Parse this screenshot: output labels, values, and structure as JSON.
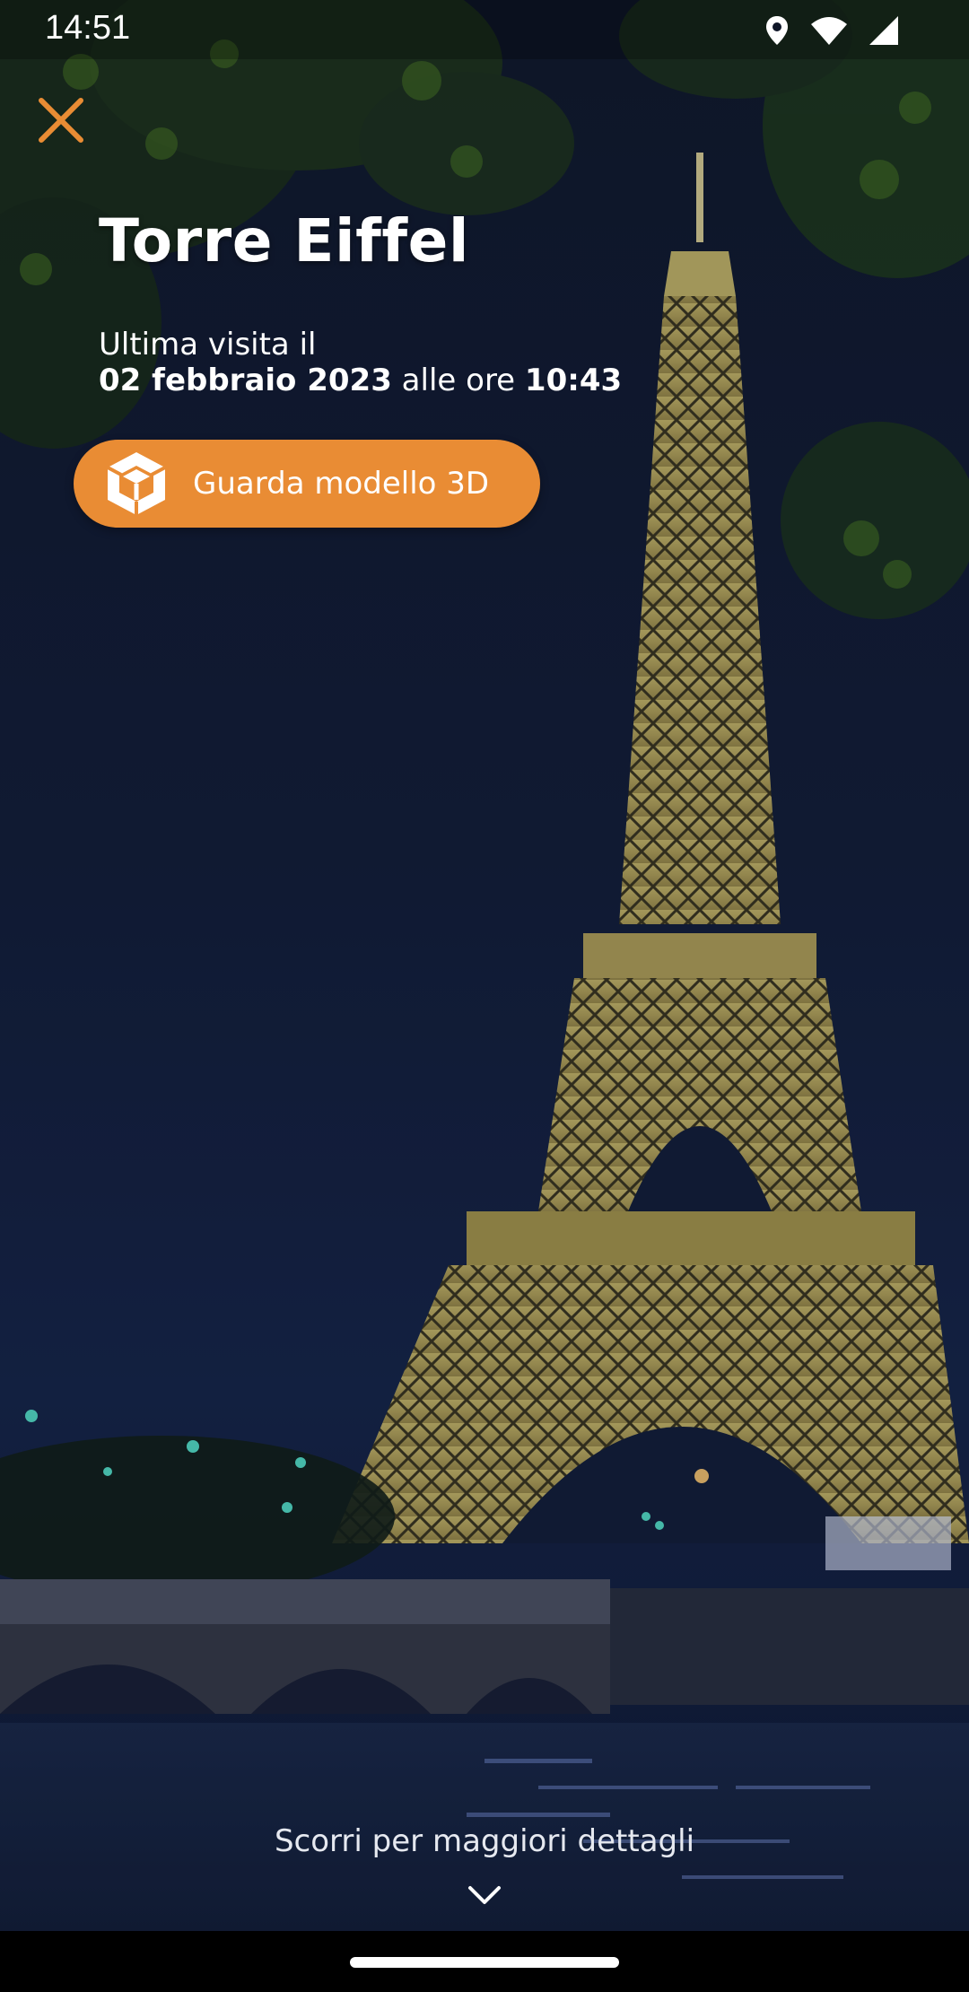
{
  "status_bar": {
    "time": "14:51"
  },
  "header": {
    "title": "Torre Eiffel"
  },
  "visit": {
    "line1": "Ultima visita il",
    "date": "02 febbraio 2023",
    "connector": " alle ore ",
    "time": "10:43"
  },
  "actions": {
    "model_3d_label": "Guarda modello 3D"
  },
  "footer": {
    "scroll_hint": "Scorri per maggiori dettagli"
  },
  "colors": {
    "accent": "#e98c34",
    "background_night": "#0d1628"
  },
  "icons": [
    "location-icon",
    "wifi-icon",
    "signal-icon",
    "close-icon",
    "cube-3d-icon",
    "chevron-down-icon"
  ]
}
